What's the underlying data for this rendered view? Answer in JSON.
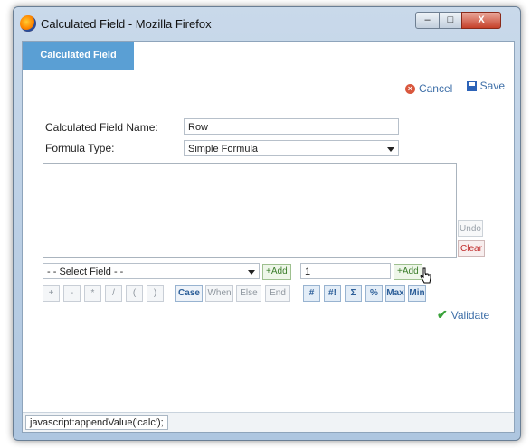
{
  "window": {
    "title": "Calculated Field - Mozilla Firefox",
    "buttons": {
      "minimize": "–",
      "maximize": "□",
      "close": "X"
    }
  },
  "tab": {
    "label": "Calculated Field"
  },
  "actions": {
    "cancel_label": "Cancel",
    "save_label": "Save"
  },
  "form": {
    "name_label": "Calculated Field Name:",
    "name_value": "Row",
    "type_label": "Formula Type:",
    "type_value": "Simple Formula"
  },
  "formula_box": {
    "value": ""
  },
  "side_buttons": {
    "undo": "Undo",
    "clear": "Clear"
  },
  "select_field": {
    "value": "- - Select Field - -"
  },
  "add_label": "+Add",
  "value_input": {
    "value": "1"
  },
  "operators": [
    "+",
    "-",
    "*",
    "/",
    "(",
    ")"
  ],
  "keywords": [
    "Case",
    "When",
    "Else",
    "End"
  ],
  "functions": [
    "#",
    "#!",
    "Σ",
    "%",
    "Max",
    "Min"
  ],
  "validate_label": "Validate",
  "status_bar": {
    "text": "javascript:appendValue('calc');"
  },
  "colors": {
    "tab_bg": "#5a9fd4",
    "link": "#3e6fa8",
    "add_green": "#3a7d2a",
    "clear_red": "#c02a2a"
  }
}
